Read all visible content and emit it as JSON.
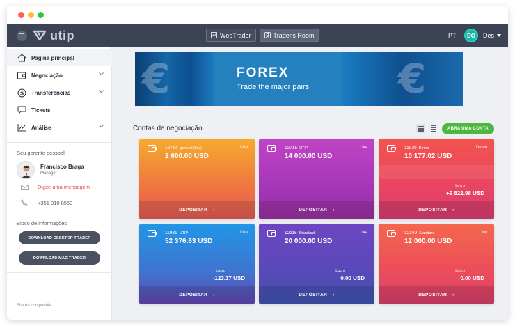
{
  "header": {
    "logo_text": "utip",
    "nav": [
      {
        "label": "WebTrader",
        "icon": "chart-icon"
      },
      {
        "label": "Trader's Room",
        "icon": "user-icon"
      }
    ],
    "language": "PT",
    "avatar_initials": "DO",
    "user_name": "Des"
  },
  "sidebar": {
    "items": [
      {
        "label": "Página principal",
        "icon": "home-icon"
      },
      {
        "label": "Negociação",
        "icon": "wallet-icon"
      },
      {
        "label": "Transferências",
        "icon": "dollar-icon"
      },
      {
        "label": "Tickets",
        "icon": "chat-icon"
      },
      {
        "label": "Análise",
        "icon": "analytics-icon"
      }
    ],
    "manager_heading": "Seu gerente pessoal",
    "manager_name": "Francisco Braga",
    "manager_role": "Manager",
    "message_label": "Digite uma mensagem",
    "phone": "+351 010 8553",
    "info_heading": "Bloco de informações",
    "download_desktop": "DOWNLOAD DESKTOP TRADER",
    "download_mac": "DOWNLOAD MAC TRADER",
    "site_link": "Site da companhia"
  },
  "banner": {
    "title": "FOREX",
    "subtitle": "Trade the major pairs"
  },
  "accounts": {
    "title": "Contas de negociação",
    "open_account": "ABRA UMA CONTA",
    "deposit_label": "DEPOSITAR",
    "profit_label": "Lucro",
    "cards": [
      {
        "number": "12714",
        "type": "general (live)",
        "status": "Live",
        "balance": "2 600.00 USD",
        "profit": ""
      },
      {
        "number": "12715",
        "type": "UTIP",
        "status": "Live",
        "balance": "14 000.00 USD",
        "profit": ""
      },
      {
        "number": "11930",
        "type": "Demo",
        "status": "Demo",
        "balance": "10 177.02 USD",
        "profit": "+9 822.98 USD"
      },
      {
        "number": "11931",
        "type": "UTIP",
        "status": "Live",
        "balance": "52 376.63 USD",
        "profit": "-123.37 USD"
      },
      {
        "number": "12116",
        "type": "Standard",
        "status": "Live",
        "balance": "20 000.00 USD",
        "profit": "0.00 USD"
      },
      {
        "number": "12349",
        "type": "Standard",
        "status": "Live",
        "balance": "12 000.00 USD",
        "profit": "0.00 USD"
      }
    ]
  },
  "colors": {
    "topbar": "#3b4354",
    "accent_green": "#4cb83f",
    "danger_text": "#e0474c"
  }
}
